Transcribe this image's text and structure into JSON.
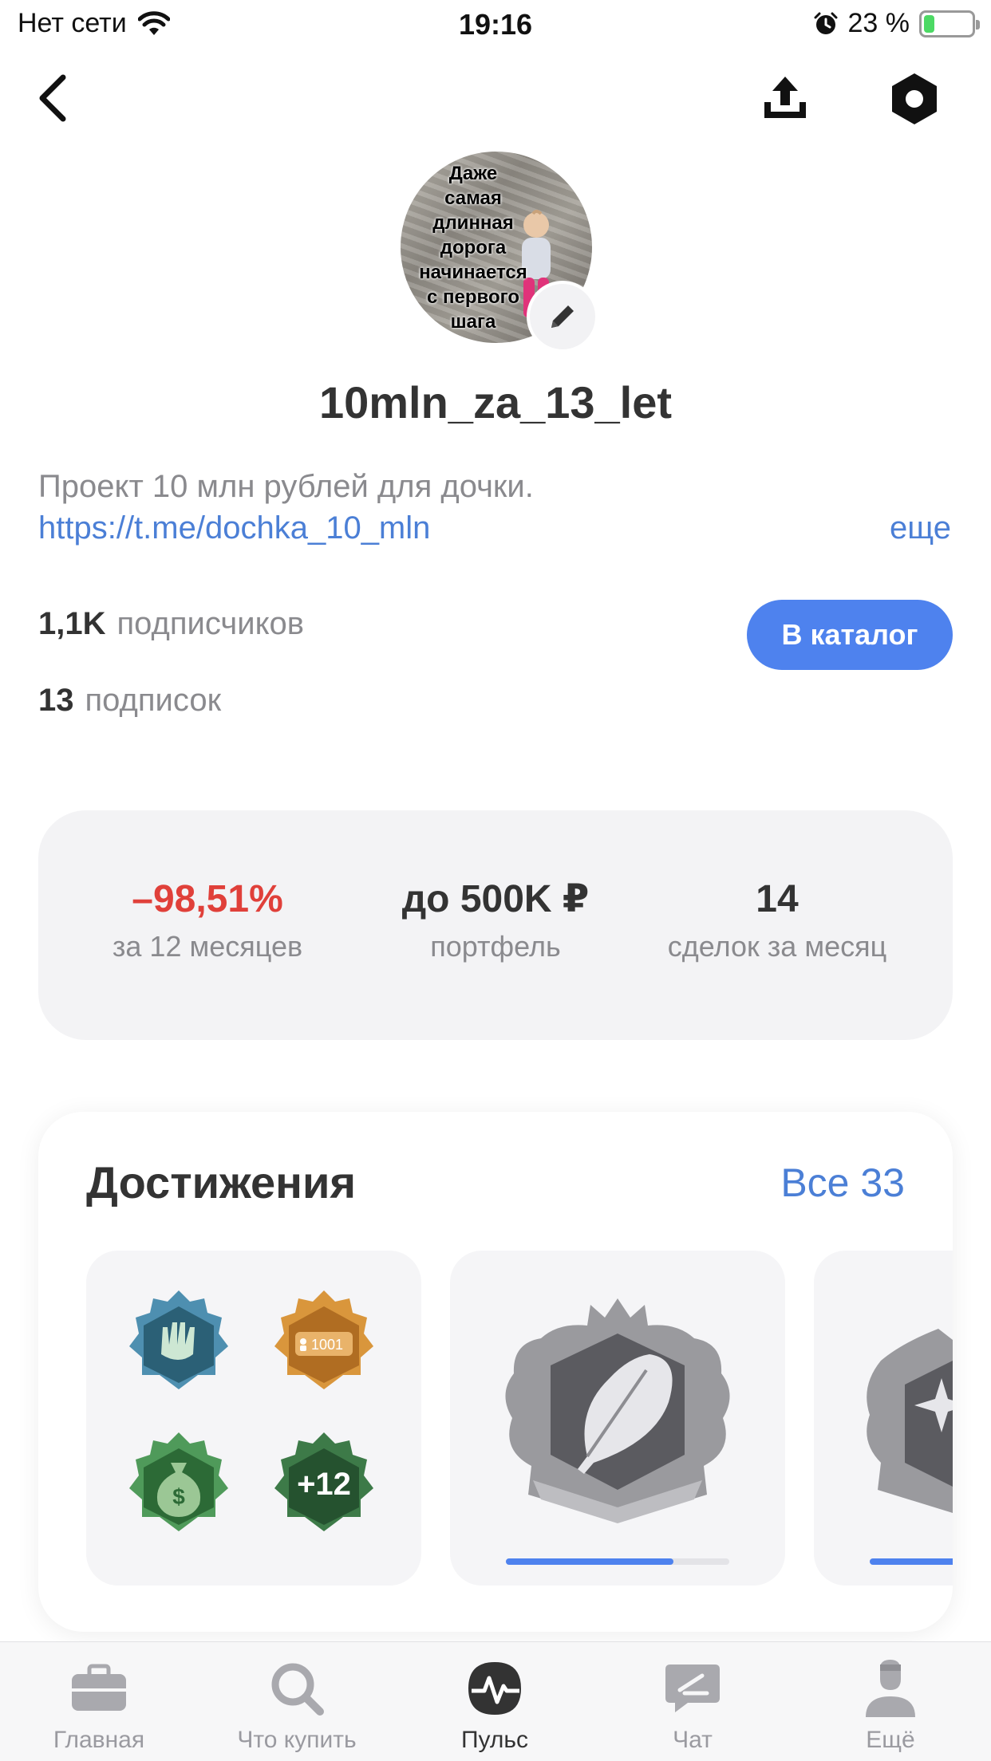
{
  "status_bar": {
    "network": "Нет сети",
    "time": "19:16",
    "battery_percent": "23 %",
    "battery_level": 0.23,
    "icons": [
      "wifi-icon",
      "alarm-icon",
      "battery-icon"
    ]
  },
  "top_bar": {
    "icons": [
      "chevron-left-icon",
      "share-upload-icon",
      "settings-hexagon-icon"
    ]
  },
  "profile": {
    "avatar_caption": [
      "Даже",
      "самая",
      "длинная",
      "дорога",
      "начинается",
      "с первого",
      "шага"
    ],
    "username": "10mln_za_13_let",
    "bio": "Проект 10 млн рублей для дочки.",
    "link": "https://t.me/dochka_10_mln",
    "more_label": "еще",
    "followers_count": "1,1K",
    "followers_label": "подписчиков",
    "following_count": "13",
    "following_label": "подписок",
    "catalog_button": "В каталог"
  },
  "stats": [
    {
      "value": "–98,51%",
      "label": "за 12 месяцев"
    },
    {
      "value": "до 500K ₽",
      "label": "портфель"
    },
    {
      "value": "14",
      "label": "сделок за месяц"
    }
  ],
  "achievements": {
    "title": "Достижения",
    "all_label": "Все 33",
    "badge_group": {
      "badges": [
        "hands-badge-icon",
        "subscribers-badge-icon",
        "money-bag-badge-icon",
        "more-badge-icon"
      ],
      "badge_number": "1001",
      "more_count": "+12"
    },
    "tiles": [
      {
        "icon": "feather-badge-icon",
        "progress": 0.75
      },
      {
        "icon": "sparkle-badge-icon",
        "progress": 0.6
      }
    ]
  },
  "nav": {
    "items": [
      {
        "label": "Главная",
        "icon": "briefcase-icon",
        "active": false
      },
      {
        "label": "Что купить",
        "icon": "search-icon",
        "active": false
      },
      {
        "label": "Пульс",
        "icon": "pulse-icon",
        "active": true
      },
      {
        "label": "Чат",
        "icon": "chat-icon",
        "active": false
      },
      {
        "label": "Ещё",
        "icon": "profile-icon",
        "active": false
      }
    ]
  },
  "colors": {
    "accent": "#4e82ee",
    "negative": "#e0403a",
    "link": "#4b7fd6",
    "muted": "#8a8a8e"
  }
}
